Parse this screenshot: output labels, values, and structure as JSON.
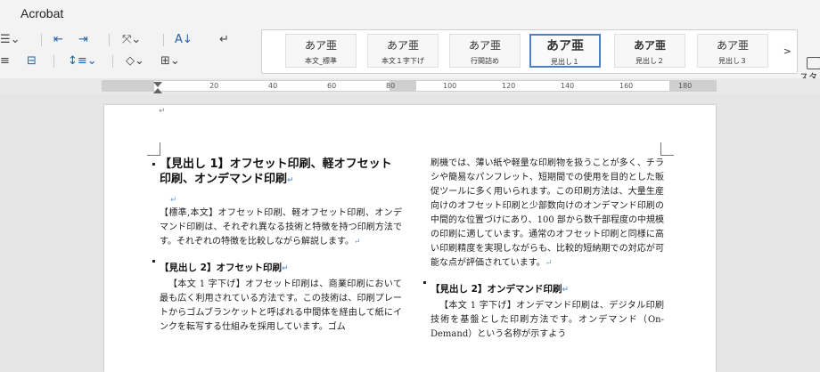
{
  "app": {
    "title": "Acrobat"
  },
  "ribbon": {
    "styles": [
      {
        "sample": "あア亜",
        "name": "本文_標準",
        "bold": false,
        "active": false
      },
      {
        "sample": "あア亜",
        "name": "本文１字下げ",
        "bold": false,
        "active": false
      },
      {
        "sample": "あア亜",
        "name": "行間詰め",
        "bold": false,
        "active": false
      },
      {
        "sample": "あア亜",
        "name": "見出し１",
        "bold": true,
        "active": true
      },
      {
        "sample": "あア亜",
        "name": "見出し２",
        "bold": true,
        "active": false
      },
      {
        "sample": "あア亜",
        "name": "見出し３",
        "bold": false,
        "active": false
      }
    ],
    "more": ">",
    "styles_pane_label": "スタ ウィン"
  },
  "ruler": {
    "labels": [
      "20",
      "40",
      "60",
      "80",
      "100",
      "120",
      "140",
      "160",
      "180"
    ]
  },
  "document": {
    "return_mark": "↵",
    "h1": "【見出し 1】オフセット印刷、軽オフセット印刷、オンデマンド印刷",
    "intro": "【標準,本文】オフセット印刷、軽オフセット印刷、オンデマンド印刷は、それぞれ異なる技術と特徴を持つ印刷方法です。それぞれの特徴を比較しながら解説します。",
    "h2_offset": "【見出し 2】オフセット印刷",
    "offset_body": "【本文 1 字下げ】オフセット印刷は、商業印刷において最も広く利用されている方法です。この技術は、印刷プレートからゴムブランケットと呼ばれる中間体を経由して紙にインクを転写する仕組みを採用しています。ゴム",
    "right_top": "刷機では、薄い紙や軽量な印刷物を扱うことが多く、チラシや簡易なパンフレット、短期間での使用を目的とした販促ツールに多く用いられます。この印刷方法は、大量生産向けのオフセット印刷と少部数向けのオンデマンド印刷の中間的な位置づけにあり、100 部から数千部程度の中規模の印刷に適しています。通常のオフセット印刷と同様に高い印刷精度を実現しながらも、比較的短納期での対応が可能な点が評価されています。",
    "h2_ondemand": "【見出し 2】オンデマンド印刷",
    "ondemand_body": "【本文 1 字下げ】オンデマンド印刷は、デジタル印刷技術を基盤とした印刷方法です。オンデマンド（On-Demand）という名称が示すよう"
  }
}
